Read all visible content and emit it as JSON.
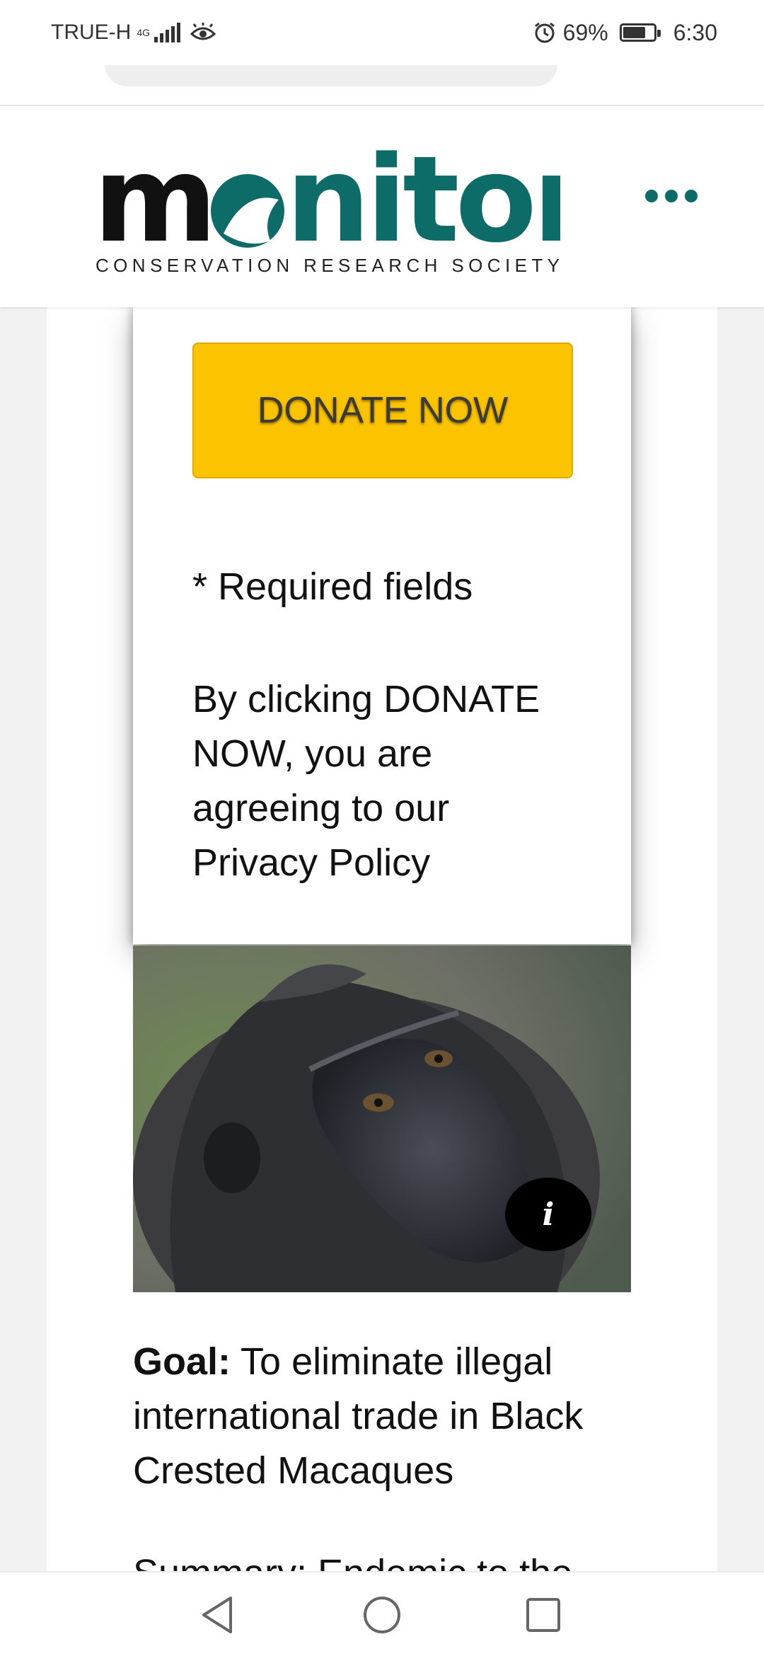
{
  "status_bar": {
    "carrier": "TRUE-H",
    "network": "4G",
    "battery_percent": "69%",
    "battery_level": 0.69,
    "time": "6:30",
    "icons": [
      "signal-icon",
      "eye-comfort-icon",
      "alarm-icon",
      "battery-icon"
    ]
  },
  "header": {
    "logo_text": "monitor",
    "tagline": "CONSERVATION RESEARCH SOCIETY",
    "menu_icon": "more-dots-icon",
    "brand_color": "#0d6b68"
  },
  "donation": {
    "button_label": "DONATE NOW",
    "button_color": "#fcc300",
    "required_note": "* Required fields",
    "agreement_text": "By clicking DONATE NOW, you are agreeing to our Privacy Policy"
  },
  "image": {
    "subject": "Black crested macaque photo",
    "info_icon": "info-icon",
    "info_label": "i"
  },
  "goal": {
    "label": "Goal:",
    "text": " To eliminate illegal international trade in Black Crested Macaques"
  },
  "summary_fragment": "Summary: Endemic to the",
  "nav_bar": {
    "icons": [
      "back-icon",
      "home-icon",
      "recents-icon"
    ]
  }
}
